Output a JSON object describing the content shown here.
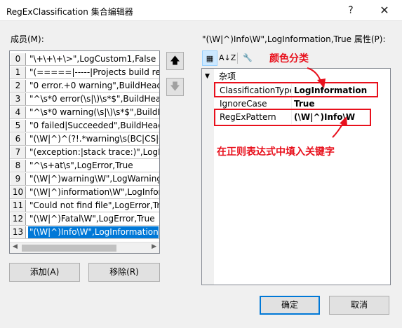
{
  "window": {
    "title": "RegExClassification 集合编辑器",
    "help": "?",
    "close": "✕"
  },
  "members_label": "成员(M):",
  "members": [
    {
      "index": "0",
      "text": "\"\\+\\+\\+\\>\",LogCustom1,False"
    },
    {
      "index": "1",
      "text": "\"(=====|-----|Projects build rep"
    },
    {
      "index": "2",
      "text": "\"0 error.+0 warning\",BuildHead"
    },
    {
      "index": "3",
      "text": "\"^\\s*0 error(\\s|\\)\\s*$\",BuildHead"
    },
    {
      "index": "4",
      "text": "\"^\\s*0 warning(\\s|\\)\\s*$\",BuildHe"
    },
    {
      "index": "5",
      "text": "\"0 failed|Succeeded\",BuildHead,"
    },
    {
      "index": "6",
      "text": "\"(\\W|^)^(?!.*warning\\s(BC|CS|CA"
    },
    {
      "index": "7",
      "text": "\"(exception:|stack trace:)\",LogErr"
    },
    {
      "index": "8",
      "text": "\"^\\s+at\\s\",LogError,True"
    },
    {
      "index": "9",
      "text": "\"(\\W|^)warning\\W\",LogWarning"
    },
    {
      "index": "10",
      "text": "\"(\\W|^)information\\W\",LogInfor"
    },
    {
      "index": "11",
      "text": "\"Could not find file\",LogError,Tr"
    },
    {
      "index": "12",
      "text": "\"(\\W|^)Fatal\\W\",LogError,True"
    },
    {
      "index": "13",
      "text": "\"(\\W|^)Info\\W\",LogInformation,",
      "selected": true
    }
  ],
  "buttons": {
    "add": "添加(A)",
    "remove": "移除(R)",
    "ok": "确定",
    "cancel": "取消",
    "move_up": "🡅",
    "move_down": "🡇"
  },
  "properties_label": "\"(\\W|^)Info\\W\",LogInformation,True 属性(P):",
  "toolbar": {
    "categorized": "▦",
    "alphabetical": "A↓Z",
    "property_pages": "🔧"
  },
  "property_grid": {
    "category": "杂项",
    "category_toggle": "▼",
    "rows": [
      {
        "name": "ClassificationType",
        "value": "LogInformation"
      },
      {
        "name": "IgnoreCase",
        "value": "True"
      },
      {
        "name": "RegExPattern",
        "value": "(\\W|^)Info\\W"
      }
    ]
  },
  "annotations": {
    "color_label": "颜色分类",
    "keyword_label": "在正则表达式中填入关键字",
    "color": "#e8101c"
  }
}
